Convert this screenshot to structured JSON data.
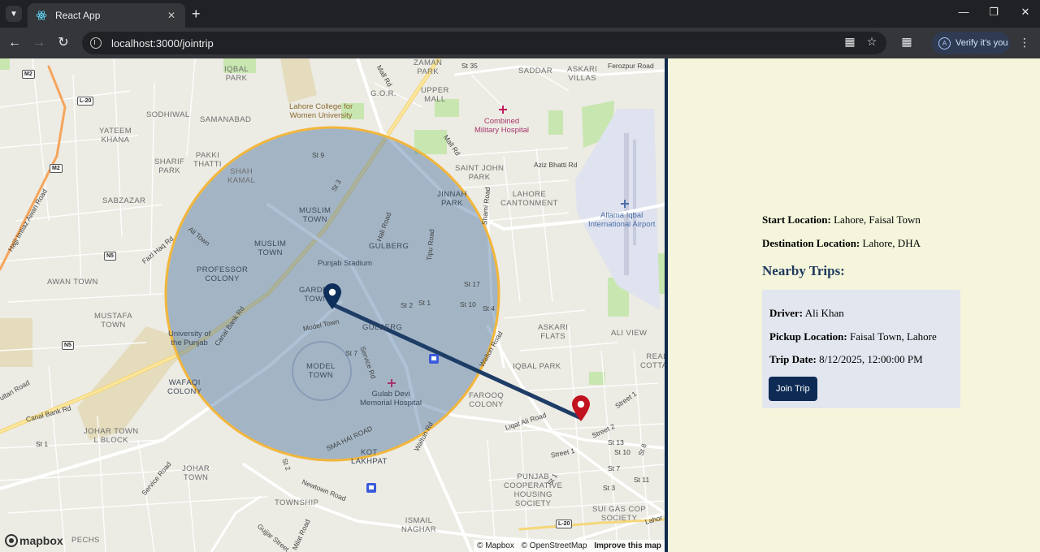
{
  "browser": {
    "tab_title": "React App",
    "url": "localhost:3000/jointrip",
    "profile_label": "Verify it's you",
    "profile_initial": "A"
  },
  "map": {
    "labels": {
      "iqbal_park": "IQBAL\nPARK",
      "zaman_park": "ZAMAN\nPARK",
      "saddar": "SADDAR",
      "askari_villas": "ASKARI\nVILLAS",
      "gor": "G.O.R.",
      "upper_mall": "UPPER\nMALL",
      "lahore_college": "Lahore College for\nWomen University",
      "sodhiwal": "SODHIWAL",
      "samanabad": "SAMANABAD",
      "combined_hospital": "Combined\nMilitary Hospital",
      "yateem_khana": "YATEEM\nKHANA",
      "sharif_park": "SHARIF\nPARK",
      "pakki_thatti": "PAKKI\nTHATTI",
      "shah_kamal": "SHAH\nKAMAL",
      "saint_john_park": "SAINT JOHN\nPARK",
      "sabzazar": "SABZAZAR",
      "lahore_cantonment": "LAHORE\nCANTONMENT",
      "jinnah_park": "JINNAH\nPARK",
      "muslim_town_1": "MUSLIM\nTOWN",
      "muslim_town_2": "MUSLIM\nTOWN",
      "allama_iqbal_airport": "Allama Iqbal\nInternational Airport",
      "gulberg_1": "GULBERG",
      "punjab_stadium": "Punjab Stadium",
      "professor_colony": "PROFESSOR\nCOLONY",
      "awan_town": "AWAN TOWN",
      "garden_town": "GARDEN\nTOWN",
      "gulberg_2": "GULBERG",
      "mustafa_town": "MUSTAFA\nTOWN",
      "askari_flats": "ASKARI\nFLATS",
      "ali_view": "ALI VIEW",
      "university_of_punjab": "University of\nthe Punjab",
      "model_town": "MODEL\nTOWN",
      "gulab_devi": "Gulab Devi\nMemorial Hospital",
      "iqbal_park_2": "IQBAL PARK",
      "real_cottage": "REAL\nCOTTAG",
      "wafaqi_colony": "WAFAQI\nCOLONY",
      "farooq_colony": "FAROOQ\nCOLONY",
      "johar_town_l": "JOHAR TOWN\nL BLOCK",
      "kot_lakhpat": "KOT\nLAKHPAT",
      "johar_town": "JOHAR\nTOWN",
      "punjab_cooperative": "PUNJAB\nCOOPERATIVE\nHOUSING\nSOCIETY",
      "township": "TOWNSHIP",
      "sui_gas": "SUI GAS COP\nSOCIETY",
      "ismail_naghar": "ISMAIL\nNAGHAR",
      "pechs": "PECHS"
    },
    "roads": {
      "mall_rd_top": "Mall Rd",
      "mall_rd": "Mall Rd",
      "st35": "St 35",
      "aziz_bhatti": "Aziz Bhatti Rd",
      "shami_road": "Shami Road",
      "st9": "St 9",
      "st3": "St 3",
      "hali_road": "Hali Road",
      "tipu_road": "Tipu Road",
      "ali_town": "Ali Town",
      "fazl_haq": "Fazl Haq Rd",
      "canal_bank_1": "Canal Bank Rd",
      "canal_bank_2": "Canal Bank Rd",
      "st17": "St 17",
      "st2": "St 2",
      "st1": "St 1",
      "st10": "St 10",
      "st4": "St 4",
      "model_town_rd": "Model Town",
      "st7": "St 7",
      "service_rd": "Service Rd",
      "walton_rd": "Walton Rd",
      "walton_road": "Walton Road",
      "sma_hai_road": "SMA HAI ROAD",
      "st2b": "St 2",
      "ligat_ali": "Liqat Ali Road",
      "street1": "Street 1",
      "street2": "Street 2",
      "st13": "St 13",
      "street_1b": "Street 1",
      "st10b": "St 10",
      "st7b": "St 7",
      "st11": "St 11",
      "st3b": "St 3",
      "st8": "St 8",
      "st1c": "St 1",
      "newtown_road": "Newtown Road",
      "service_road": "Service Road",
      "gujjar_street": "Gujjar Street",
      "milat_road": "Milat Road",
      "ultan_road": "ultan Road",
      "st1d": "St 1",
      "hajji_road": "Hajji Imtiaz Awan Road",
      "ferozpur": "Ferozpur Road",
      "lahore_rd": "Lahor"
    },
    "shields": {
      "m2a": "M2",
      "l20a": "L-20",
      "m2b": "M2",
      "n5a": "N5",
      "n5b": "N5",
      "l20b": "L-20"
    },
    "logo_text": "mapbox",
    "attribution": {
      "mapbox": "© Mapbox",
      "osm": "© OpenStreetMap",
      "improve": "Improve this map"
    },
    "colors": {
      "radius_fill": "#3f6b9a",
      "radius_stroke": "#f2b63c",
      "route": "#1d3d66",
      "start_pin": "#0e2f59",
      "end_pin": "#c1121f"
    }
  },
  "trip": {
    "start_label": "Start Location:",
    "start_value": "Lahore, Faisal Town",
    "destination_label": "Destination Location:",
    "destination_value": "Lahore, DHA",
    "nearby_title": "Nearby Trips:",
    "nearby": [
      {
        "driver_label": "Driver:",
        "driver": "Ali Khan",
        "pickup_label": "Pickup Location:",
        "pickup": "Faisal Town, Lahore",
        "date_label": "Trip Date:",
        "date": "8/12/2025, 12:00:00 PM",
        "join_label": "Join Trip"
      }
    ]
  }
}
